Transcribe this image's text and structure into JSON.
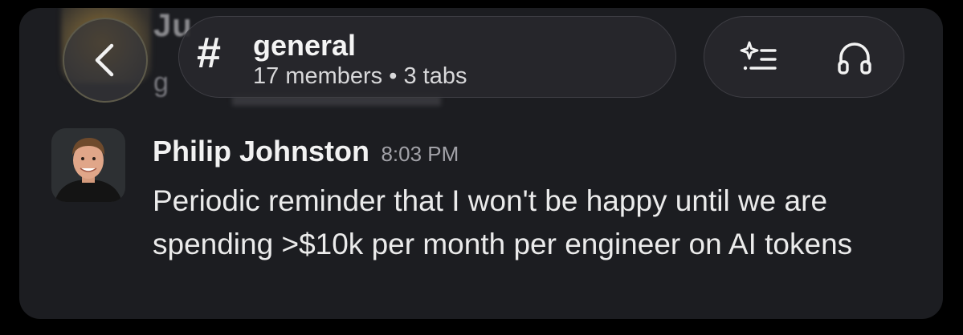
{
  "background_prev_message": {
    "author_fragment": "Ju",
    "text_fragment": "g"
  },
  "header": {
    "channel_name": "general",
    "members_label": "17 members",
    "separator": "•",
    "tabs_label": "3 tabs",
    "icons": {
      "back": "chevron-left-icon",
      "channel": "hash-icon",
      "summary": "sparkle-list-icon",
      "huddle": "headphones-icon"
    }
  },
  "message": {
    "author": "Philip Johnston",
    "timestamp": "8:03 PM",
    "text": "Periodic reminder that I won't be happy until we are spending >$10k per month per engineer on AI tokens"
  },
  "colors": {
    "page_background": "#000000",
    "panel_background": "#1c1d21",
    "pill_background": "#28282c",
    "text_primary": "#ebebeb",
    "text_secondary": "#a2a2a8"
  }
}
